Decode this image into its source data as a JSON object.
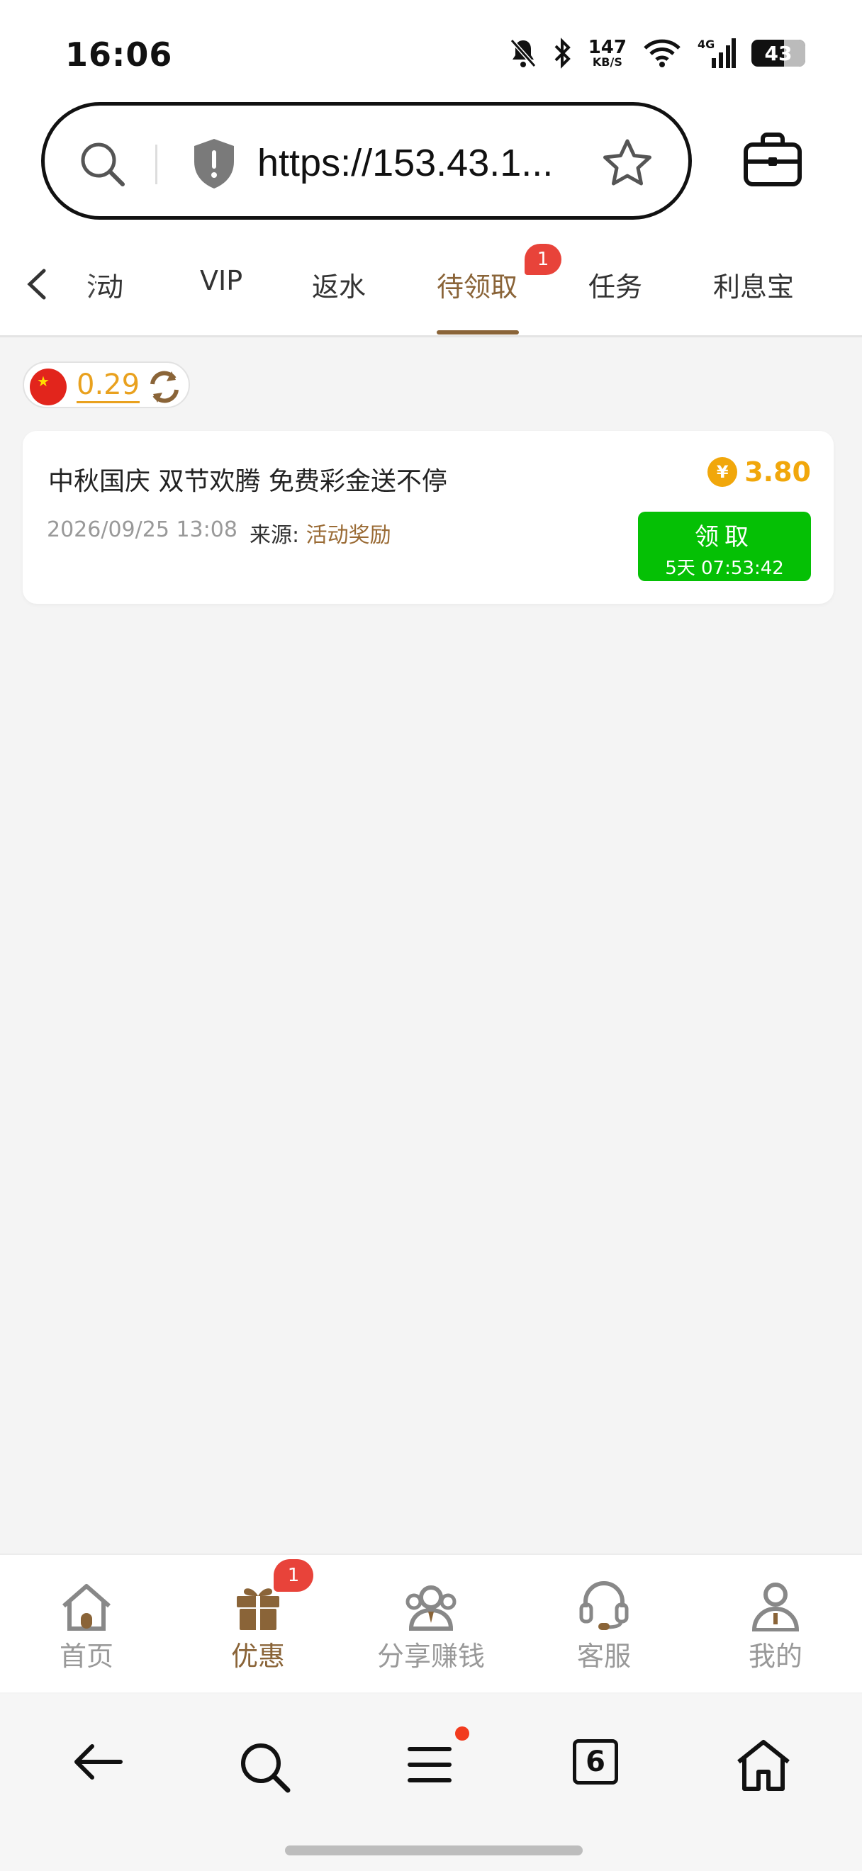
{
  "status_bar": {
    "time": "16:06",
    "net_speed_value": "147",
    "net_speed_unit": "KB/S",
    "network": "4G",
    "battery": "43"
  },
  "browser": {
    "url": "https://153.43.1...",
    "tab_count": "6"
  },
  "tabs": [
    {
      "label": "活动"
    },
    {
      "label": "VIP"
    },
    {
      "label": "返水"
    },
    {
      "label": "待领取",
      "active": true,
      "badge": "1"
    },
    {
      "label": "任务"
    },
    {
      "label": "利息宝"
    }
  ],
  "tabs_visible_first": "动",
  "balance": {
    "amount": "0.29"
  },
  "reward": {
    "title": "中秋国庆 双节欢腾 免费彩金送不停",
    "currency_symbol": "¥",
    "amount": "3.80",
    "date": "2026/09/25 13:08",
    "source_label": "来源:",
    "source_value": "活动奖励",
    "claim_label": "领取",
    "countdown": "5天 07:53:42"
  },
  "bottom_nav": [
    {
      "label": "首页",
      "icon": "home-icon"
    },
    {
      "label": "优惠",
      "icon": "gift-icon",
      "active": true,
      "badge": "1"
    },
    {
      "label": "分享赚钱",
      "icon": "share-earn-icon"
    },
    {
      "label": "客服",
      "icon": "headset-icon"
    },
    {
      "label": "我的",
      "icon": "user-icon"
    }
  ],
  "colors": {
    "accent": "#8a6438",
    "gold": "#f1a70b",
    "claim_green": "#05c005",
    "badge_red": "#e8433a"
  }
}
